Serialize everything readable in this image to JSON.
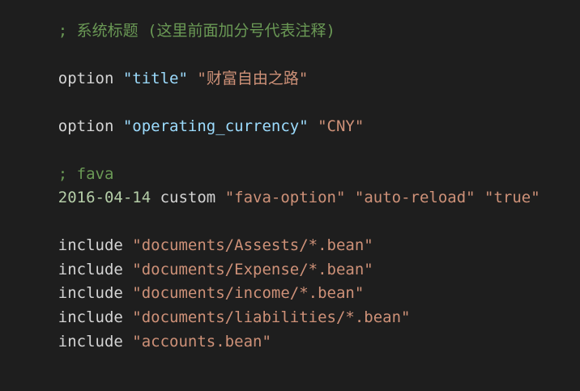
{
  "colors": {
    "background": "#1e1e1e",
    "comment": "#6a9955",
    "keyword": "#d4d4d4",
    "key_string": "#9cdcfe",
    "string": "#ce9178",
    "date": "#b5cea8"
  },
  "code": {
    "comment_title": "; 系统标题 (这里前面加分号代表注释)",
    "option_title": {
      "keyword": "option",
      "key": "\"title\"",
      "value": "\"财富自由之路\""
    },
    "option_currency": {
      "keyword": "option",
      "key": "\"operating_currency\"",
      "value": "\"CNY\""
    },
    "comment_fava": "; fava",
    "custom_line": {
      "date": "2016-04-14",
      "keyword": "custom",
      "arg1": "\"fava-option\"",
      "arg2": "\"auto-reload\"",
      "arg3": "\"true\""
    },
    "includes": [
      {
        "keyword": "include",
        "path": "\"documents/Assests/*.bean\""
      },
      {
        "keyword": "include",
        "path": "\"documents/Expense/*.bean\""
      },
      {
        "keyword": "include",
        "path": "\"documents/income/*.bean\""
      },
      {
        "keyword": "include",
        "path": "\"documents/liabilities/*.bean\""
      },
      {
        "keyword": "include",
        "path": "\"accounts.bean\""
      }
    ]
  }
}
